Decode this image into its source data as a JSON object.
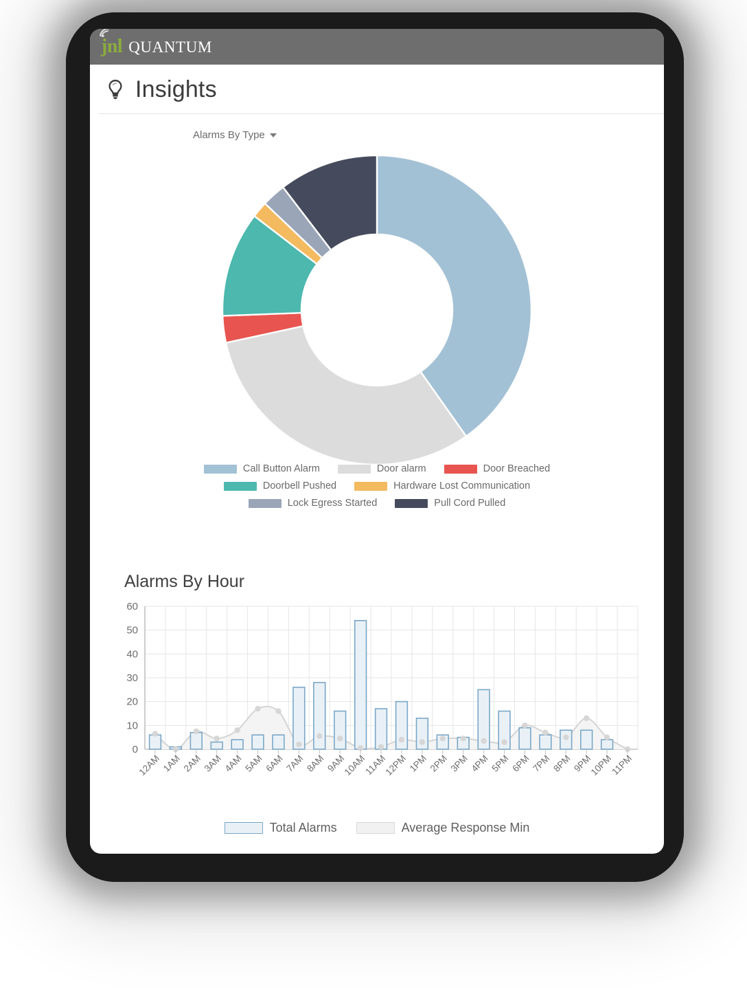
{
  "app": {
    "brand": {
      "jnl": "jnl",
      "quantum": "QUANTUM"
    },
    "page_title": "Insights",
    "accent_green": "#8cab3e",
    "header_gray": "#6e6e6e"
  },
  "chart_data": [
    {
      "type": "pie",
      "variant": "donut",
      "title": "Alarms By Type",
      "legend_position": "bottom",
      "labels": [
        "Call Button Alarm",
        "Door alarm",
        "Door Breached",
        "Doorbell Pushed",
        "Hardware Lost Communication",
        "Lock Egress Started",
        "Pull Cord Pulled"
      ],
      "values": [
        40.2,
        31.4,
        2.8,
        11.0,
        1.7,
        2.5,
        10.4
      ],
      "colors": [
        "#a3c1d5",
        "#dcdcdc",
        "#e8544f",
        "#4cb8ae",
        "#f3ba60",
        "#9aa5b8",
        "#454b5c"
      ]
    },
    {
      "type": "bar",
      "title": "Alarms By Hour",
      "xlabel": "",
      "ylabel": "",
      "ylim": [
        0,
        60
      ],
      "yticks": [
        0,
        10,
        20,
        30,
        40,
        50,
        60
      ],
      "grid": true,
      "legend_position": "bottom",
      "categories": [
        "12AM",
        "1AM",
        "2AM",
        "3AM",
        "4AM",
        "5AM",
        "6AM",
        "7AM",
        "8AM",
        "9AM",
        "10AM",
        "11AM",
        "12PM",
        "1PM",
        "2PM",
        "3PM",
        "4PM",
        "5PM",
        "6PM",
        "7PM",
        "8PM",
        "9PM",
        "10PM",
        "11PM"
      ],
      "series": [
        {
          "name": "Total Alarms",
          "type": "bar",
          "color": "#e9f1f7",
          "border_color": "#7aa7c7",
          "values": [
            6,
            1,
            7,
            3,
            4,
            6,
            6,
            26,
            28,
            16,
            54,
            17,
            20,
            13,
            6,
            5,
            25,
            16,
            9,
            6,
            8,
            8,
            4,
            0
          ]
        },
        {
          "name": "Average Response Min",
          "type": "area",
          "color": "#f1f1f1",
          "border_color": "#d8d8d8",
          "values": [
            6.5,
            0,
            7.5,
            4.5,
            8,
            17,
            16,
            2,
            5.5,
            4.5,
            0.5,
            1,
            4,
            3,
            4.5,
            4.5,
            3.5,
            3,
            10,
            7,
            5,
            13,
            5,
            0
          ]
        }
      ]
    }
  ]
}
